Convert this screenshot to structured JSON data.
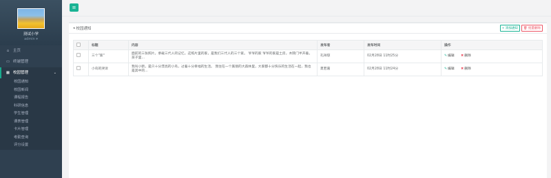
{
  "sidebar": {
    "school_name": "测试小学",
    "user": "admin",
    "items": [
      {
        "label": "主页",
        "icon": "home-icon",
        "glyph": "⌂"
      },
      {
        "label": "终端管理",
        "icon": "monitor-icon",
        "glyph": "▭"
      },
      {
        "label": "校园管理",
        "icon": "school-icon",
        "glyph": "▦",
        "chevron": "⌄"
      }
    ],
    "submenu": [
      "校园通知",
      "校园新闻",
      "课程报告",
      "科研信息",
      "学生管理",
      "课表管理",
      "卡片管理",
      "考勤查询",
      "评分设置"
    ]
  },
  "topbar": {
    "menu_glyph": "≡"
  },
  "panel": {
    "title": "校园通知",
    "title_glyph": "◂",
    "add_label": "+ 添加通知",
    "delete_label": "批量删除",
    "delete_glyph": "🗑"
  },
  "table": {
    "headers": [
      "标题",
      "内容",
      "发布者",
      "发布时间",
      "操作"
    ],
    "rows": [
      {
        "title": "三个\"家\"",
        "content": "面前的三张照片，承载三代人的记忆，这照片里的家，是我们三代人的三个家。 爷爷的家 爷爷的家是土房，木院门半开着，孩子里...",
        "author": "孔祥琼",
        "time": "02月28日 11时25分",
        "edit": "编辑",
        "delete": "删除"
      },
      {
        "title": "小鸟的哭诉",
        "content": "我叫小鹤，是只十分漂亮的小鸟，过着十分幸福的生活。 我住在一个美丽的大森林里，大家都十分快乐的生活在一起，我也是其中的...",
        "author": "夏若嘉",
        "time": "02月28日 11时24分",
        "edit": "编辑",
        "delete": "删除"
      }
    ]
  },
  "colors": {
    "sidebar": "#2f4050",
    "accent": "#1ab394",
    "danger": "#ed5565"
  }
}
